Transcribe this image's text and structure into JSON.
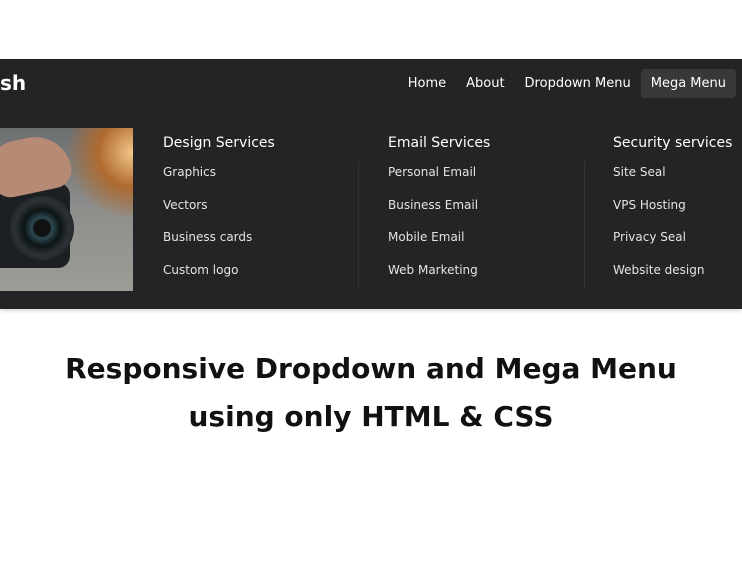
{
  "nav": {
    "logo": "sh",
    "links": [
      "Home",
      "About",
      "Dropdown Menu",
      "Mega Menu"
    ],
    "active": "Mega Menu"
  },
  "mega": {
    "columns": [
      {
        "title": "Design Services",
        "items": [
          "Graphics",
          "Vectors",
          "Business cards",
          "Custom logo"
        ]
      },
      {
        "title": "Email Services",
        "items": [
          "Personal Email",
          "Business Email",
          "Mobile Email",
          "Web Marketing"
        ]
      },
      {
        "title": "Security services",
        "items": [
          "Site Seal",
          "VPS Hosting",
          "Privacy Seal",
          "Website design"
        ]
      }
    ]
  },
  "heading": {
    "line1": "Responsive Dropdown and Mega Menu",
    "line2": "using only HTML & CSS"
  }
}
